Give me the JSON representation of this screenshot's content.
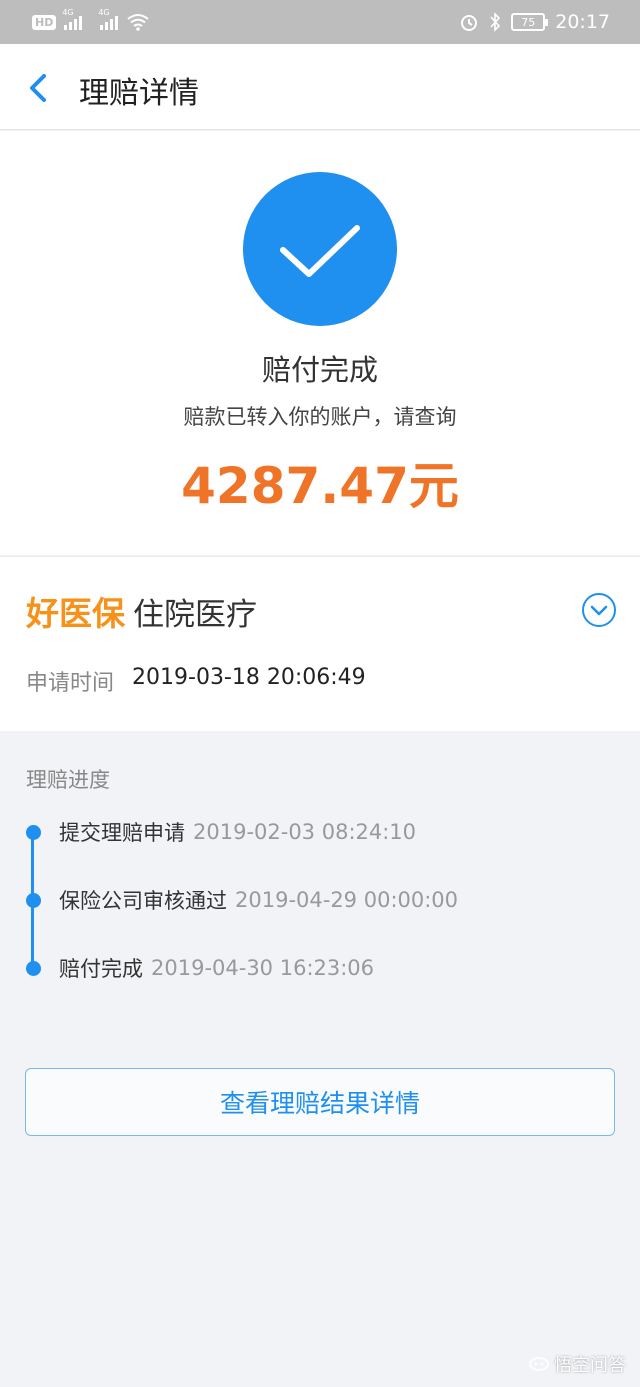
{
  "statusbar": {
    "left_badge": "HD",
    "network_1": "4G",
    "network_2": "4G",
    "battery": "75",
    "time": "20:17"
  },
  "header": {
    "title": "理赔详情"
  },
  "status": {
    "title": "赔付完成",
    "subtitle": "赔款已转入你的账户，请查询",
    "amount": "4287.47元"
  },
  "product": {
    "brand": "好医保",
    "type": "住院医疗",
    "apply_label": "申请时间",
    "apply_time": "2019-03-18 20:06:49"
  },
  "progress": {
    "title": "理赔进度",
    "steps": [
      {
        "name": "提交理赔申请",
        "time": "2019-02-03 08:24:10"
      },
      {
        "name": "保险公司审核通过",
        "time": "2019-04-29 00:00:00"
      },
      {
        "name": "赔付完成",
        "time": "2019-04-30 16:23:06"
      }
    ]
  },
  "actions": {
    "view_result": "查看理赔结果详情"
  },
  "watermark": "悟空问答",
  "colors": {
    "accent": "#1f8ff0",
    "amount": "#f07428",
    "brand": "#f7911a"
  }
}
